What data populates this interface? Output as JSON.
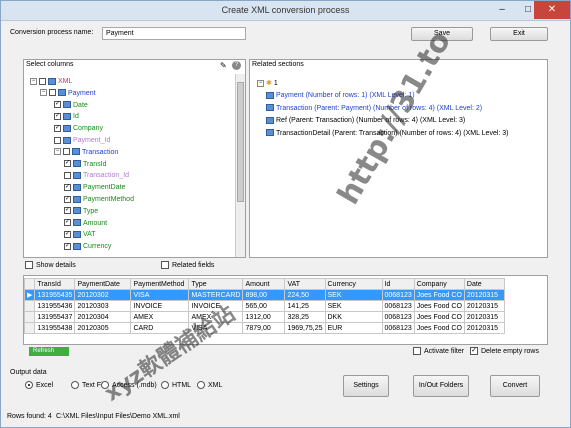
{
  "window": {
    "title": "Create XML conversion process",
    "minimize": "–",
    "maximize": "□",
    "close": "✕"
  },
  "top": {
    "name_label": "Conversion process name:",
    "name_value": "Payment",
    "save": "Save",
    "exit": "Exit"
  },
  "select_columns": {
    "title": "Select columns",
    "tree": [
      {
        "text": "XML",
        "color": "#c0306a",
        "expand": "−",
        "checked": false
      },
      {
        "text": "Payment",
        "color": "#1f3fd0",
        "expand": "−",
        "checked": false
      },
      {
        "text": "Date",
        "color": "#1a8a1a",
        "checked": true
      },
      {
        "text": "Id",
        "color": "#1a8a1a",
        "checked": true
      },
      {
        "text": "Company",
        "color": "#1a8a1a",
        "checked": true
      },
      {
        "text": "Payment_Id",
        "color": "#b37ad6",
        "checked": false
      },
      {
        "text": "Transaction",
        "color": "#1f3fd0",
        "expand": "−",
        "checked": false
      },
      {
        "text": "TransId",
        "color": "#1a8a1a",
        "checked": true
      },
      {
        "text": "Transaction_Id",
        "color": "#b37ad6",
        "checked": false
      },
      {
        "text": "PaymentDate",
        "color": "#1a8a1a",
        "checked": true
      },
      {
        "text": "PaymentMethod",
        "color": "#1a8a1a",
        "checked": true
      },
      {
        "text": "Type",
        "color": "#1a8a1a",
        "checked": true
      },
      {
        "text": "Amount",
        "color": "#1a8a1a",
        "checked": true
      },
      {
        "text": "VAT",
        "color": "#1a8a1a",
        "checked": true
      },
      {
        "text": "Currency",
        "color": "#1a8a1a",
        "checked": true
      }
    ],
    "show_details": "Show details",
    "related_fields": "Related fields"
  },
  "related_sections": {
    "title": "Related sections",
    "root": "1",
    "items": [
      "Payment (Number of rows: 1) (XML Level: 1)",
      "Transaction (Parent: Payment) (Number of rows: 4) (XML Level: 2)",
      "Ref (Parent: Transaction) (Number of rows: 4) (XML Level: 3)",
      "TransactionDetail (Parent: Transaction) (Number of rows: 4) (XML Level: 3)"
    ]
  },
  "grid": {
    "columns": [
      "",
      "TransId",
      "PaymentDate",
      "PaymentMethod",
      "Type",
      "Amount",
      "VAT",
      "Currency",
      "Id",
      "Company",
      "Date"
    ],
    "rows": [
      [
        "▶",
        "131955435",
        "20120302",
        "VISA",
        "MASTERCARD",
        "898,00",
        "224,50",
        "SEK",
        "0068123",
        "Joes Food CO",
        "20120315"
      ],
      [
        "",
        "131955436",
        "20120303",
        "INVOICE",
        "INVOICE",
        "565,00",
        "141,25",
        "SEK",
        "0068123",
        "Joes Food CO",
        "20120315"
      ],
      [
        "",
        "131955437",
        "20120304",
        "AMEX",
        "AMEX",
        "1312,00",
        "328,25",
        "DKK",
        "0068123",
        "Joes Food CO",
        "20120315"
      ],
      [
        "",
        "131955438",
        "20120305",
        "CARD",
        "VISA",
        "7879,00",
        "1969,75,25",
        "EUR",
        "0068123",
        "Joes Food CO",
        "20120315"
      ]
    ],
    "refresh": "Refresh",
    "activate_filter": "Activate filter",
    "delete_empty_rows": "Delete empty rows"
  },
  "output": {
    "label": "Output data",
    "options": [
      "Excel",
      "Text File",
      "Access (.mdb)",
      "HTML",
      "XML"
    ],
    "selected": "Excel",
    "settings": "Settings",
    "in_out_folders": "In/Out Folders",
    "convert": "Convert"
  },
  "status": {
    "rows_found": "Rows found: 4",
    "path": "C:\\XML Files\\Input Files\\Demo XML.xml"
  },
  "watermark": {
    "url": "http://31.to",
    "cjk": "xyz軟體補給站"
  }
}
